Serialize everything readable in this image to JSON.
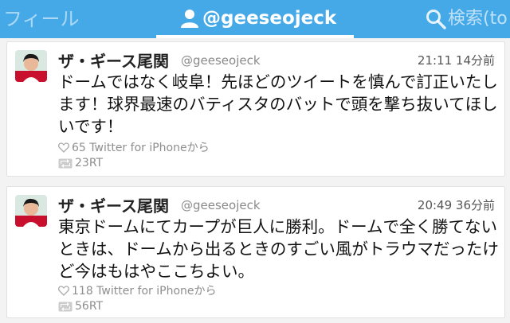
{
  "tabs": {
    "left_label": "フィール",
    "center_label": "@geeseojeck",
    "right_label": "検索(to"
  },
  "icons": {
    "user": "user-icon",
    "search": "search-icon",
    "heart": "heart-icon",
    "retweet": "retweet-icon"
  },
  "colors": {
    "header": "#45a9e8",
    "tab_underline": "#ffffff"
  },
  "tweets": [
    {
      "name": "ザ・ギース尾関",
      "handle": "@geeseojeck",
      "time": "21:11 14分前",
      "text": "ドームではなく岐阜！先ほどのツイートを慎んで訂正いたします！球界最速のバティスタのバットで頭を撃ち抜いてほしいです！",
      "favs": "65 Twitter for iPhoneから",
      "rts": "23RT"
    },
    {
      "name": "ザ・ギース尾関",
      "handle": "@geeseojeck",
      "time": "20:49 36分前",
      "text": "東京ドームにてカープが巨人に勝利。ドームで全く勝てないときは、ドームから出るときのすごい風がトラウマだったけど今はもはやここちよい。",
      "favs": "118 Twitter for iPhoneから",
      "rts": "56RT"
    }
  ]
}
